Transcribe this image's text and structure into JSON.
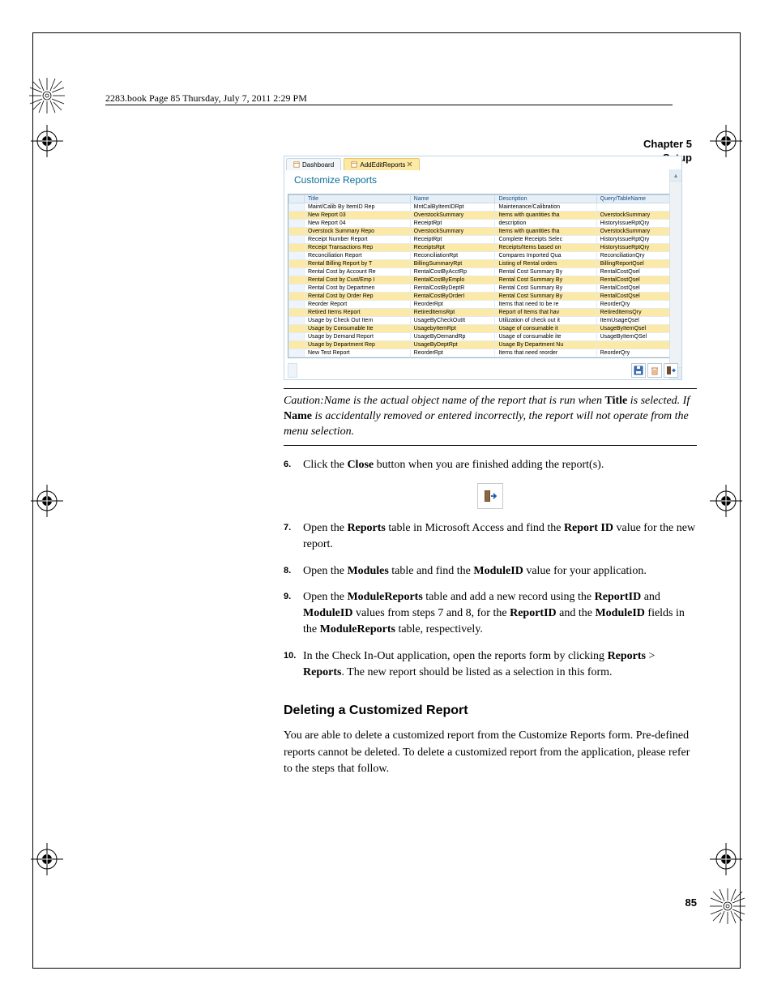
{
  "book_header": "2283.book  Page 85  Thursday, July 7, 2011  2:29 PM",
  "chapter_line1": "Chapter 5",
  "chapter_line2": "Setup",
  "app": {
    "tab_inactive": "Dashboard",
    "tab_active": "AddEditReports",
    "pane_title": "Customize Reports",
    "columns": [
      "Title",
      "Name",
      "Description",
      "Query/TableName"
    ],
    "rows": [
      {
        "sel": false,
        "alt": false,
        "c": [
          "Maint/Calib By ItemID Rep",
          "MntCalByItemIDRpt",
          "Maintenance/Calibration",
          ""
        ]
      },
      {
        "sel": true,
        "alt": false,
        "c": [
          "New Report 03",
          "OverstockSummary",
          "Items with quantities tha",
          "OverstockSummary"
        ]
      },
      {
        "sel": false,
        "alt": false,
        "c": [
          "New Report 04",
          "ReceiptRpt",
          "description",
          "HistoryIssueRptQry"
        ]
      },
      {
        "sel": true,
        "alt": false,
        "c": [
          "Overstock Summary Repo",
          "OverstockSummary",
          "Items with quantities tha",
          "OverstockSummary"
        ]
      },
      {
        "sel": false,
        "alt": false,
        "c": [
          "Receipt Number Report",
          "ReceiptRpt",
          "Complete Receipts Selec",
          "HistoryIssueRptQry"
        ]
      },
      {
        "sel": true,
        "alt": false,
        "c": [
          "Receipt Transactions Rep",
          "ReceiptsRpt",
          "Receipts/Items based on",
          "HistoryIssueRptQry"
        ]
      },
      {
        "sel": false,
        "alt": false,
        "c": [
          "Reconciliation Report",
          "ReconciliationRpt",
          "Compares Imported Qua",
          "ReconciliationQry"
        ]
      },
      {
        "sel": true,
        "alt": false,
        "c": [
          "Rental Billing Report by T",
          "BillingSummaryRpt",
          "Listing of Rental orders",
          "BillingReportQsel"
        ]
      },
      {
        "sel": false,
        "alt": false,
        "c": [
          "Rental Cost by Account Re",
          "RentalCostByAcctRp",
          "Rental Cost Summary By",
          "RentalCostQsel"
        ]
      },
      {
        "sel": true,
        "alt": false,
        "c": [
          "Rental Cost by Cust/Emp I",
          "RentalCostByEmplo",
          "Rental Cost Summary By",
          "RentalCostQsel"
        ]
      },
      {
        "sel": false,
        "alt": false,
        "c": [
          "Rental Cost by Departmen",
          "RentalCostByDeptR",
          "Rental Cost Summary By",
          "RentalCostQsel"
        ]
      },
      {
        "sel": true,
        "alt": false,
        "c": [
          "Rental Cost by Order Rep",
          "RentalCostByOrderI",
          "Rental Cost Summary By",
          "RentalCostQsel"
        ]
      },
      {
        "sel": false,
        "alt": false,
        "c": [
          "Reorder Report",
          "ReorderRpt",
          "Items that need to be re",
          "ReorderQry"
        ]
      },
      {
        "sel": true,
        "alt": false,
        "c": [
          "Retired Items Report",
          "RetiredItemsRpt",
          "Report of Items that hav",
          "RetiredItemsQry"
        ]
      },
      {
        "sel": false,
        "alt": false,
        "c": [
          "Usage by Check Out Item",
          "UsageByCheckOutIt",
          "Utilization of check out it",
          "ItemUsageQsel"
        ]
      },
      {
        "sel": true,
        "alt": false,
        "c": [
          "Usage by Consumable Ite",
          "UsagebyItemRpt",
          "Usage of consumable it",
          "UsageByItemQsel"
        ]
      },
      {
        "sel": false,
        "alt": false,
        "c": [
          "Usage by Demand Report",
          "UsageByDemandRp",
          "Usage of consumable ite",
          "UsageByItemQSel"
        ]
      },
      {
        "sel": true,
        "alt": false,
        "c": [
          "Usage by Department Rep",
          "UsageByDeptRpt",
          "Usage By Department Nu",
          ""
        ]
      },
      {
        "sel": false,
        "alt": false,
        "c": [
          "New Test Report",
          "ReorderRpt",
          "Items that need reorder",
          "ReorderQry"
        ]
      }
    ]
  },
  "caution_lead": "Caution:",
  "caution_text_1": "Name is the actual object name of the report that is run when ",
  "caution_bold_title": "Title",
  "caution_text_2": " is selected. If ",
  "caution_bold_name": "Name",
  "caution_text_3": " is accidentally removed or entered incorrectly, the report will not operate from the menu selection.",
  "steps": {
    "s6_num": "6.",
    "s6": {
      "a": "Click the ",
      "b": "Close",
      "c": " button when you are finished adding the report(s)."
    },
    "s7_num": "7.",
    "s7": {
      "a": "Open the ",
      "b": "Reports",
      "c": " table in Microsoft Access and find the ",
      "d": "Report ID",
      "e": " value for the new report."
    },
    "s8_num": "8.",
    "s8": {
      "a": "Open the ",
      "b": "Modules",
      "c": " table and find the ",
      "d": "ModuleID",
      "e": " value for your application."
    },
    "s9_num": "9.",
    "s9": {
      "a": "Open the ",
      "b": "ModuleReports",
      "c": " table and add a new record using the ",
      "d": "ReportID",
      "e": " and ",
      "f": "ModuleID",
      "g": " values from steps 7 and 8, for the ",
      "h": "ReportID",
      "i": " and the ",
      "j": "ModuleID",
      "k": " fields in the ",
      "l": "ModuleReports",
      "m": " table, respectively."
    },
    "s10_num": "10.",
    "s10": {
      "a": "In the Check In-Out application, open the reports form by clicking ",
      "b": "Reports",
      "c": " > ",
      "d": "Reports",
      "e": ". The new report should be listed as a selection in this form."
    }
  },
  "section_title": "Deleting a Customized Report",
  "section_body": "You are able to delete a customized report from the Customize Reports form. Pre-defined reports cannot be deleted. To delete a customized report from the application, please refer to the steps that follow.",
  "page_number": "85"
}
